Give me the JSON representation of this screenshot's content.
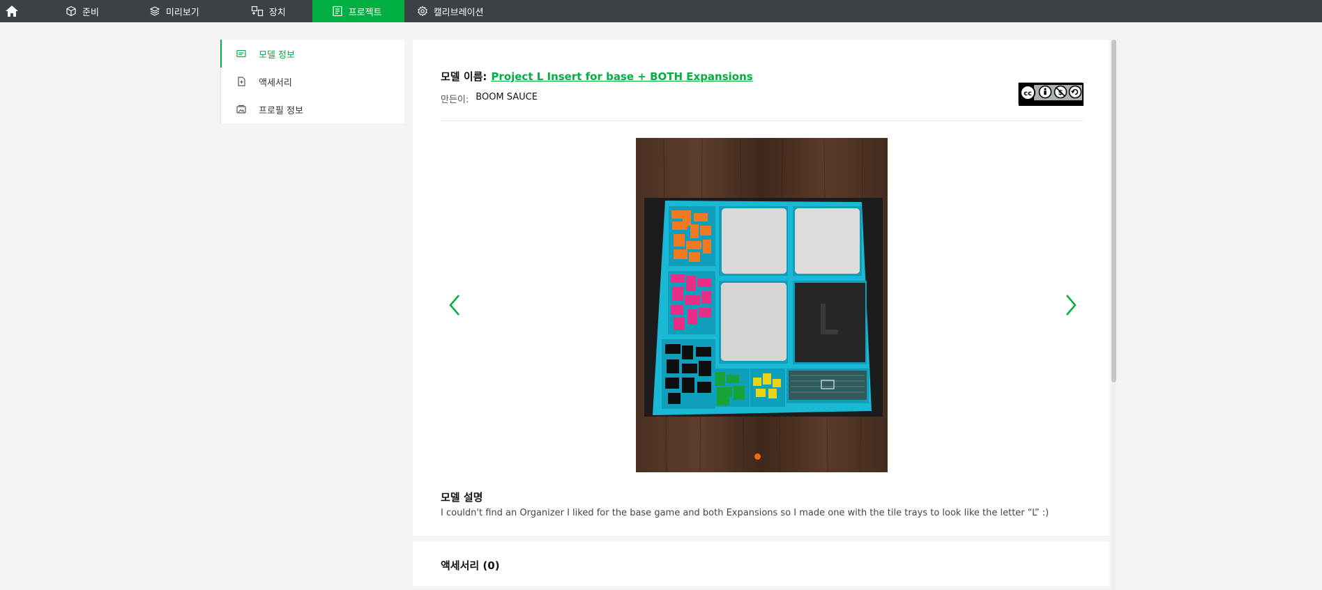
{
  "nav": {
    "tabs": [
      {
        "label": "준비",
        "icon": "cube-icon"
      },
      {
        "label": "미리보기",
        "icon": "layers-icon"
      },
      {
        "label": "장치",
        "icon": "device-icon"
      },
      {
        "label": "프로젝트",
        "icon": "project-icon",
        "active": true
      },
      {
        "label": "캘리브레이션",
        "icon": "calibration-icon"
      }
    ]
  },
  "sidebar": {
    "items": [
      {
        "label": "모델 정보",
        "icon": "model-info-icon",
        "active": true
      },
      {
        "label": "액세서리",
        "icon": "accessory-icon"
      },
      {
        "label": "프로필 정보",
        "icon": "profile-icon"
      }
    ]
  },
  "model": {
    "name_label": "모델 이름:",
    "name": "Project L Insert for base + BOTH Expansions",
    "creator_label": "만든이:",
    "creator": "BOOM SAUCE",
    "license": {
      "icon": "cc-by-nc-sa-icon",
      "tags": [
        "BY",
        "NC",
        "SA"
      ]
    },
    "description_label": "모델 설명",
    "description": "I couldn't find an Organizer I liked for the base game and both Expansions so I made one with the tile trays to look like the letter “L” :)"
  },
  "accessories": {
    "label": "액세서리 (0)"
  },
  "colors": {
    "accent": "#00ae42",
    "nav_bg": "#3b4144",
    "carousel_dot": "#ff6a00"
  }
}
